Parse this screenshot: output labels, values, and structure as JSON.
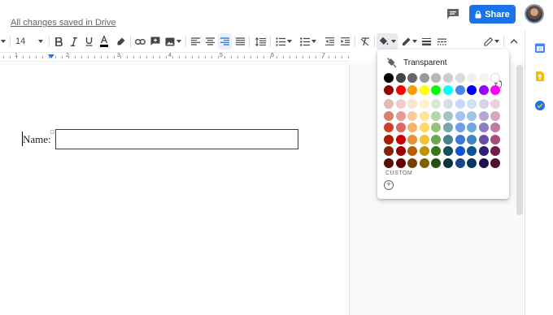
{
  "header": {
    "save_status": "All changes saved in Drive",
    "share_label": "Share"
  },
  "toolbar": {
    "font_size": "14"
  },
  "ruler": {
    "numbers": [
      "1",
      "2",
      "3",
      "4",
      "5",
      "6",
      "7"
    ]
  },
  "document": {
    "field_label": "Name:"
  },
  "color_picker": {
    "transparent_label": "Transparent",
    "custom_label": "CUSTOM",
    "add_custom_symbol": "+",
    "hovered_swatch": "white",
    "grays": [
      "#000000",
      "#434343",
      "#666666",
      "#999999",
      "#b7b7b7",
      "#cccccc",
      "#d9d9d9",
      "#efefef",
      "#f3f3f3",
      "#ffffff"
    ],
    "brights": [
      "#980000",
      "#ff0000",
      "#ff9900",
      "#ffff00",
      "#00ff00",
      "#00ffff",
      "#4a86e8",
      "#0000ff",
      "#9900ff",
      "#ff00ff"
    ],
    "shades": [
      [
        "#e6b8af",
        "#f4cccc",
        "#fce5cd",
        "#fff2cc",
        "#d9ead3",
        "#d0e0e3",
        "#c9daf8",
        "#cfe2f3",
        "#d9d2e9",
        "#ead1dc"
      ],
      [
        "#dd7e6b",
        "#ea9999",
        "#f9cb9c",
        "#ffe599",
        "#b6d7a8",
        "#a2c4c9",
        "#a4c2f4",
        "#9fc5e8",
        "#b4a7d6",
        "#d5a6bd"
      ],
      [
        "#cc4125",
        "#e06666",
        "#f6b26b",
        "#ffd966",
        "#93c47d",
        "#76a5af",
        "#6d9eeb",
        "#6fa8dc",
        "#8e7cc3",
        "#c27ba0"
      ],
      [
        "#a61c00",
        "#cc0000",
        "#e69138",
        "#f1c232",
        "#6aa84f",
        "#45818e",
        "#3c78d8",
        "#3d85c6",
        "#674ea7",
        "#a64d79"
      ],
      [
        "#85200c",
        "#990000",
        "#b45f06",
        "#bf9000",
        "#38761d",
        "#134f5c",
        "#1155cc",
        "#0b5394",
        "#351c75",
        "#741b47"
      ],
      [
        "#5b0f00",
        "#660000",
        "#783f04",
        "#7f6000",
        "#274e13",
        "#0c343d",
        "#1c4587",
        "#073763",
        "#20124d",
        "#4c1130"
      ]
    ]
  },
  "colors": {
    "accent": "#1a73e8",
    "side_calendar": "#4285f4",
    "side_keep": "#fbbc04",
    "side_tasks": "#1a73e8"
  }
}
